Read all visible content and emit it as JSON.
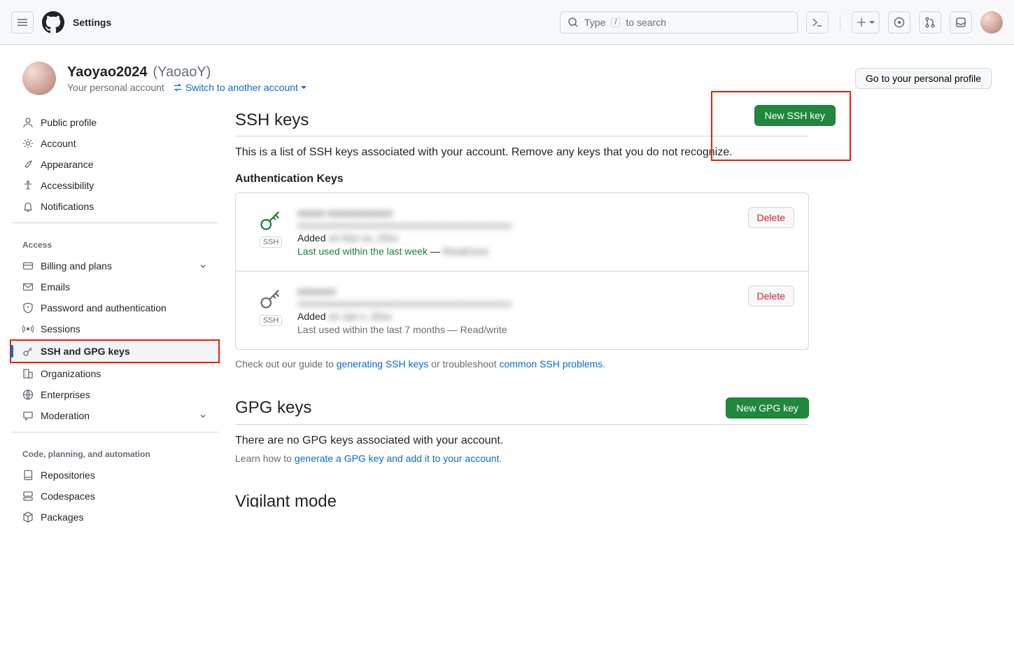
{
  "topbar": {
    "settings_label": "Settings",
    "search_prefix": "Type",
    "search_suffix": "to search",
    "search_key": "/"
  },
  "account_header": {
    "display_name": "Yaoyao2024",
    "handle": "(YaoaoY)",
    "subtitle": "Your personal account",
    "switch_label": "Switch to another account",
    "profile_button": "Go to your personal profile"
  },
  "sidebar": {
    "items_top": [
      {
        "label": "Public profile",
        "icon": "person"
      },
      {
        "label": "Account",
        "icon": "gear"
      },
      {
        "label": "Appearance",
        "icon": "brush"
      },
      {
        "label": "Accessibility",
        "icon": "accessibility"
      },
      {
        "label": "Notifications",
        "icon": "bell"
      }
    ],
    "group_access": "Access",
    "items_access": [
      {
        "label": "Billing and plans",
        "icon": "card",
        "chev": true
      },
      {
        "label": "Emails",
        "icon": "mail"
      },
      {
        "label": "Password and authentication",
        "icon": "shield"
      },
      {
        "label": "Sessions",
        "icon": "broadcast"
      },
      {
        "label": "SSH and GPG keys",
        "icon": "key",
        "active": true
      },
      {
        "label": "Organizations",
        "icon": "org"
      },
      {
        "label": "Enterprises",
        "icon": "globe"
      },
      {
        "label": "Moderation",
        "icon": "comment",
        "chev": true
      }
    ],
    "group_code": "Code, planning, and automation",
    "items_code": [
      {
        "label": "Repositories",
        "icon": "repo"
      },
      {
        "label": "Codespaces",
        "icon": "codespace"
      },
      {
        "label": "Packages",
        "icon": "package"
      }
    ]
  },
  "ssh": {
    "title": "SSH keys",
    "new_button": "New SSH key",
    "description": "This is a list of SSH keys associated with your account. Remove any keys that you do not recognize.",
    "auth_keys_title": "Authentication Keys",
    "keys": [
      {
        "name_blur": "xxxxx xxxxxxxxxxxx",
        "fp_blur": "xxxxxxxxxxxxxxxxxxxxxxxxxxxxxxxxxxxxxxxxxxxxxxxxxxx",
        "added_prefix": "Added",
        "added_blur": "on Nov xx, 20xx",
        "last_used": "Last used within the last week",
        "dash": " — ",
        "rw_blur": "Read/xxxx",
        "tag": "SSH",
        "color": "green"
      },
      {
        "name_blur": "xxxxxxx",
        "fp_blur": "xxxxxxxxxxxxxxxxxxxxxxxxxxxxxxxxxxxxxxxxxxxxxxxxxxx",
        "added_prefix": "Added",
        "added_blur": "on Jan x, 20xx",
        "last_used": "Last used within the last 7 months — Read/write",
        "tag": "SSH",
        "color": "grey"
      }
    ],
    "delete_label": "Delete",
    "helper_prefix": "Check out our guide to ",
    "helper_link1": "generating SSH keys",
    "helper_middle": " or troubleshoot ",
    "helper_link2": "common SSH problems",
    "helper_suffix": "."
  },
  "gpg": {
    "title": "GPG keys",
    "new_button": "New GPG key",
    "empty": "There are no GPG keys associated with your account.",
    "learn_prefix": "Learn how to ",
    "learn_link": "generate a GPG key and add it to your account",
    "learn_suffix": "."
  },
  "vigilant_title": "Vigilant mode"
}
